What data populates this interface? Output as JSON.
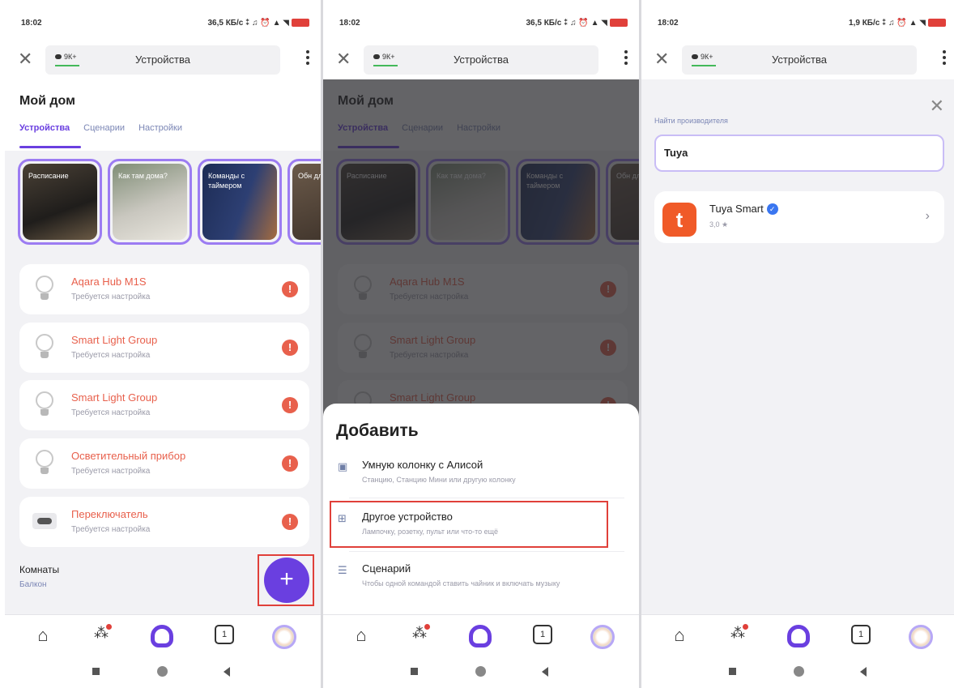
{
  "status": [
    {
      "time": "18:02",
      "right": "36,5 КБ/с ⁑ ♫ ⏰ ▲ ◥"
    },
    {
      "time": "18:02",
      "right": "36,5 КБ/с ⁑ ♫ ⏰ ▲ ◥"
    },
    {
      "time": "18:02",
      "right": "1,9 КБ/с ⁑ ♫ ⏰ ▲ ◥"
    }
  ],
  "topbar": {
    "title": "Устройства",
    "pill": "9К+",
    "close": "✕"
  },
  "home": {
    "title": "Мой дом",
    "tabs": [
      "Устройства",
      "Сценарии",
      "Настройки"
    ]
  },
  "stories": [
    "Расписание",
    "Как там дома?",
    "Команды с таймером",
    "Обн для у"
  ],
  "devices": [
    {
      "name": "Aqara Hub M1S",
      "sub": "Требуется настройка",
      "icon": "bulb-icon"
    },
    {
      "name": "Smart Light Group",
      "sub": "Требуется настройка",
      "icon": "bulb-icon"
    },
    {
      "name": "Smart Light Group",
      "sub": "Требуется настройка",
      "icon": "bulb-icon"
    },
    {
      "name": "Осветительный прибор",
      "sub": "Требуется настройка",
      "icon": "bulb-icon"
    },
    {
      "name": "Переключатель",
      "sub": "Требуется настройка",
      "icon": "switch-icon"
    }
  ],
  "rooms": {
    "title": "Комнаты",
    "sub": "Балкон"
  },
  "fab": "+",
  "warn": "!",
  "add_sheet": {
    "title": "Добавить",
    "options": [
      {
        "title": "Умную колонку с Алисой",
        "sub": "Станцию, Станцию Мини или другую колонку"
      },
      {
        "title": "Другое устройство",
        "sub": "Лампочку, розетку, пульт или что-то ещё"
      },
      {
        "title": "Сценарий",
        "sub": "Чтобы одной командой ставить чайник и включать музыку"
      }
    ]
  },
  "search": {
    "label": "Найти производителя",
    "value": "Tuya",
    "result_name": "Tuya Smart",
    "result_rating": "3,0 ★",
    "logo_letter": "t"
  },
  "nav": {
    "tabs_count": "1"
  },
  "colors": {
    "accent": "#6a3fe0",
    "warning": "#e8604c",
    "highlight": "#e0403a",
    "tuya": "#f05a28"
  }
}
